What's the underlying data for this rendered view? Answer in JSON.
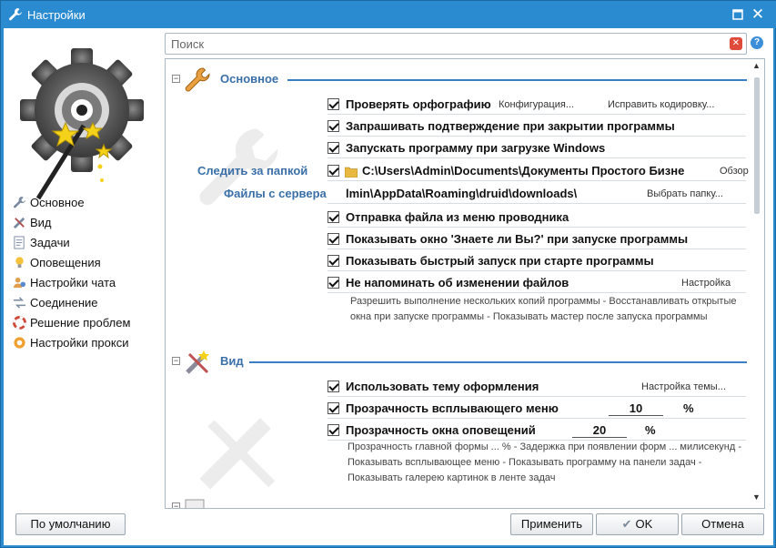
{
  "window": {
    "title": "Настройки",
    "title_icon": "wrench-icon"
  },
  "search": {
    "placeholder": "Поиск"
  },
  "nav": {
    "items": [
      {
        "label": "Основное",
        "icon": "wrench-icon"
      },
      {
        "label": "Вид",
        "icon": "brush-icon"
      },
      {
        "label": "Задачи",
        "icon": "task-icon"
      },
      {
        "label": "Оповещения",
        "icon": "bulb-icon"
      },
      {
        "label": "Настройки чата",
        "icon": "chat-icon"
      },
      {
        "label": "Соединение",
        "icon": "connection-icon"
      },
      {
        "label": "Решение проблем",
        "icon": "lifebuoy-icon"
      },
      {
        "label": "Настройки прокси",
        "icon": "proxy-icon"
      }
    ]
  },
  "sections": {
    "basic": {
      "title": "Основное",
      "options": [
        {
          "label": "Проверять орфографию",
          "checked": true
        },
        {
          "label": "Запрашивать подтверждение при закрытии программы",
          "checked": true
        },
        {
          "label": "Запускать программу при загрузке Windows",
          "checked": true
        },
        {
          "label": "Отправка файла из меню проводника",
          "checked": true
        },
        {
          "label": "Показывать окно 'Знаете ли Вы?' при запуске программы",
          "checked": true
        },
        {
          "label": "Показывать быстрый запуск при старте программы",
          "checked": true
        },
        {
          "label": "Не напоминать об изменении файлов",
          "checked": true
        }
      ],
      "spell_links": {
        "config": "Конфигурация...",
        "fix_encoding": "Исправить кодировку..."
      },
      "watch_folder": {
        "label": "Следить за папкой",
        "checked": true,
        "path": "C:\\Users\\Admin\\Documents\\Документы Простого Бизне",
        "button": "Обзор"
      },
      "server_files": {
        "label": "Файлы с сервера",
        "path": "lmin\\AppData\\Roaming\\druid\\downloads\\",
        "button": "Выбрать папку..."
      },
      "files_link": "Настройка",
      "sublinks": [
        "Разрешить выполнение нескольких копий программы",
        "Восстанавливать открытые окна при запуске программы",
        "Показывать мастер после запуска программы"
      ]
    },
    "view": {
      "title": "Вид",
      "theme": {
        "label": "Использовать тему оформления",
        "checked": true,
        "link": "Настройка темы..."
      },
      "menu_transparency": {
        "label": "Прозрачность всплывающего меню",
        "checked": true,
        "value": "10",
        "unit": "%"
      },
      "notify_transparency": {
        "label": "Прозрачность окна оповещений",
        "checked": true,
        "value": "20",
        "unit": "%"
      },
      "sublinks": [
        "Прозрачность главной формы ... %",
        "Задержка при появлении форм ... милисекунд",
        "Показывать всплывающее меню",
        "Показывать программу на панели задач",
        "Показывать галерею картинок в ленте задач"
      ]
    }
  },
  "buttons": {
    "defaults": "По умолчанию",
    "apply": "Применить",
    "ok": "OK",
    "cancel": "Отмена"
  },
  "colors": {
    "titlebar": "#2a8bd0",
    "section_title": "#3a6fa8",
    "section_line": "#3a7fc4"
  }
}
